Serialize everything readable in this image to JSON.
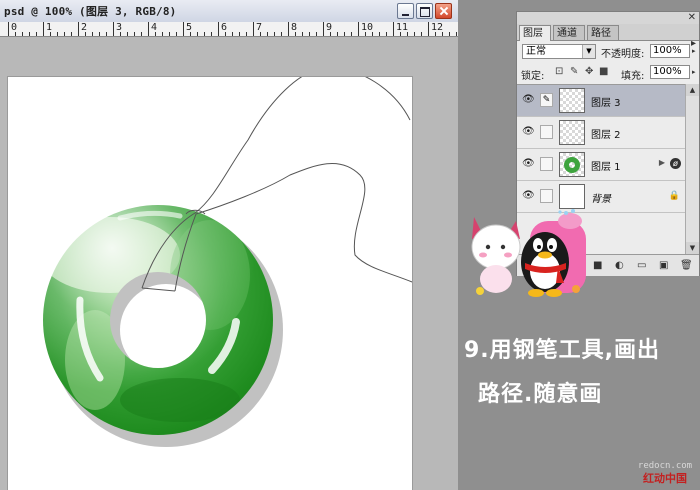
{
  "document": {
    "title": "psd @ 100% (图层 3, RGB/8)",
    "ruler_labels": [
      "0",
      "1",
      "2",
      "3",
      "4",
      "5",
      "6",
      "7",
      "8",
      "9",
      "10",
      "11",
      "12"
    ]
  },
  "layers_panel": {
    "tabs": [
      {
        "label": "图层",
        "active": true
      },
      {
        "label": "通道",
        "active": false
      },
      {
        "label": "路径",
        "active": false
      }
    ],
    "blend_mode": "正常",
    "opacity_label": "不透明度:",
    "opacity_value": "100%",
    "lock_label": "锁定:",
    "fill_label": "填充:",
    "fill_value": "100%",
    "layers": [
      {
        "name": "图层 3",
        "active": true,
        "thumb": "transparent"
      },
      {
        "name": "图层 2",
        "active": false,
        "thumb": "transparent"
      },
      {
        "name": "图层 1",
        "active": false,
        "thumb": "ring",
        "fx": "ø"
      },
      {
        "name": "背景",
        "active": false,
        "thumb": "white",
        "locked": true
      }
    ]
  },
  "caption": {
    "line1": "9.用钢笔工具,画出",
    "line2": "路径.随意画"
  },
  "watermark": {
    "url": "redocn.com",
    "name": "红动中国"
  },
  "colors": {
    "jade_dark": "#1e8b1e",
    "jade_light": "#7ccb6e",
    "active_layer": "#b6bac6",
    "caption_text": "#ffffff"
  }
}
